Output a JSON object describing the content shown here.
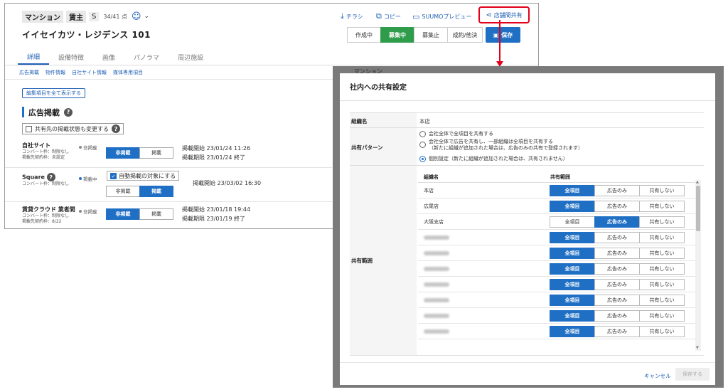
{
  "main": {
    "header": {
      "category": "マンション",
      "type": "賃主",
      "grade": "S",
      "score": "34/41 点",
      "property_name": "イイセイカツ・レジデンス 101"
    },
    "actions": {
      "flyer": "チラシ",
      "copy": "コピー",
      "preview": "SUUMOプレビュー",
      "share": "店舗間共有"
    },
    "status": [
      "作成中",
      "募集中",
      "募集止",
      "成約/他決"
    ],
    "save": "保存",
    "tabs": [
      "詳細",
      "設備特徴",
      "画像",
      "パノラマ",
      "周辺施設"
    ],
    "sublinks": [
      "広告掲載",
      "物件情報",
      "自社サイト情報",
      "媒体専用項目"
    ],
    "expand_all": "編集項目を全て表示する",
    "section_title": "広告掲載",
    "change_checkbox": "共有先の掲載状態も変更する",
    "rows": [
      {
        "name": "自社サイト",
        "sub1": "コンバート枠：制限なし",
        "sub2": "掲載先契約枠：未設定",
        "status": "非掲載",
        "opt_off": "非掲載",
        "opt_on": "掲載",
        "date1": "掲載開始 23/01/24 11:26",
        "date2": "掲載期限 23/01/24 終了"
      },
      {
        "name": "Square",
        "sub1": "コンバート枠：制限なし",
        "sub2": "",
        "status": "掲載中",
        "auto": "自動掲載の対象にする",
        "opt_off": "非掲載",
        "opt_on": "掲載",
        "date1": "掲載開始 23/03/02 16:30",
        "date2": ""
      },
      {
        "name": "賃貸クラウド 業者間",
        "sub1": "コンバート枠：制限なし",
        "sub2": "掲載先契約枠：8/22",
        "status": "非掲載",
        "opt_off": "非掲載",
        "opt_on": "掲載",
        "date1": "掲載開始 23/01/18 19:44",
        "date2": "掲載期限 23/01/19 終了"
      }
    ]
  },
  "modal": {
    "title": "社内への共有設定",
    "org_label": "組織名",
    "org_value": "本店",
    "pattern_label": "共有パターン",
    "patterns": [
      "会社全体で全項目を共有する",
      "会社全体で広告を共有し、一部組織は全項目を共有する",
      "（新たに組織が追加された場合は、広告のみの共有で登録されます）",
      "個別設定（新たに組織が追加された場合は、共有されません）"
    ],
    "range_label": "共有範囲",
    "col_org": "組織名",
    "col_range": "共有範囲",
    "opts": [
      "全項目",
      "広告のみ",
      "共有しない"
    ],
    "orgs": [
      {
        "name": "本店",
        "sel": 0
      },
      {
        "name": "広尾店",
        "sel": 0
      },
      {
        "name": "大阪支店",
        "sel": 1
      },
      {
        "name": "",
        "sel": 0
      },
      {
        "name": "",
        "sel": 0
      },
      {
        "name": "",
        "sel": 0
      },
      {
        "name": "",
        "sel": 0
      },
      {
        "name": "",
        "sel": 0
      },
      {
        "name": "",
        "sel": 0
      },
      {
        "name": "",
        "sel": 0
      }
    ],
    "cancel": "キャンセル",
    "save": "保存する"
  },
  "colors": {
    "accent": "#1f6fc5",
    "active_status": "#2e9c4a",
    "highlight": "#e2001a"
  }
}
